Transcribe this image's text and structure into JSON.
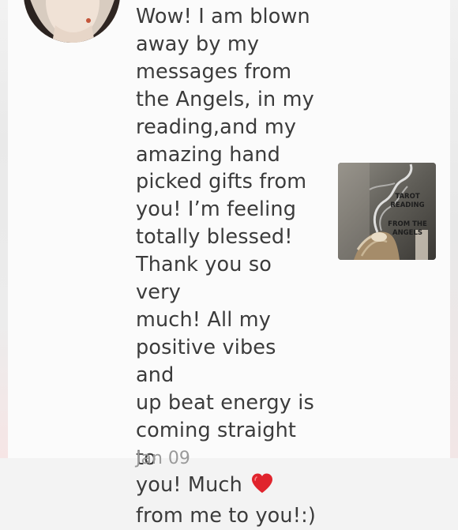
{
  "comment": {
    "text": "Wow! I am blown\naway by my\nmessages from\nthe Angels, in my\nreading,and my\namazing hand\npicked gifts from\nyou! I’m feeling\ntotally blessed!\nThank you so very\nmuch! All my\npositive vibes and\nup beat energy is\ncoming straight to\nyou! Much ",
    "text_tail": "\nfrom me to you!:)",
    "emoji": "heart-icon",
    "timestamp": "Jan 09"
  },
  "listing_thumbnail": {
    "line1": "TAROT",
    "line2": "READING",
    "line3": "FROM THE",
    "line4": "ANGELS"
  },
  "colors": {
    "text": "#3b3b3b",
    "heart": "#e0242d",
    "background": "#fbfbfb"
  }
}
